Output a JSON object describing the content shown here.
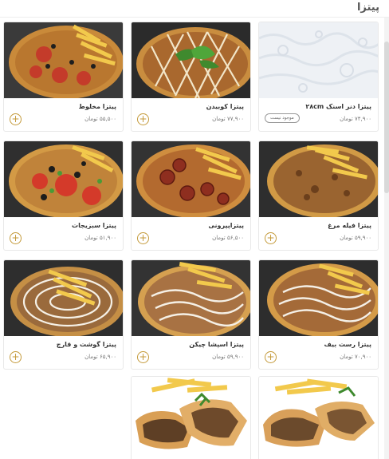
{
  "section": {
    "title": "پیتزا"
  },
  "colors": {
    "accent": "#c49a3a",
    "border": "#e8e8e8"
  },
  "products": [
    {
      "name": "پیتزا دنر اسنک ۲۸cm",
      "price": "۷۴,۹۰۰ تومان",
      "status": "موجود نیست",
      "image": "placeholder-pattern"
    },
    {
      "name": "پیتزا کوبیدن",
      "price": "۷۷,۹۰۰ تومان",
      "add_icon": "plus-icon",
      "image": "kubideh-pizza"
    },
    {
      "name": "پیتزا مخلوط",
      "price": "۵۵,۵۰۰ تومان",
      "add_icon": "plus-icon",
      "image": "mixed-pizza"
    },
    {
      "name": "پیتزا فیله مرغ",
      "price": "۵۹,۹۰۰ تومان",
      "add_icon": "plus-icon",
      "image": "chicken-fillet-pizza"
    },
    {
      "name": "پیتزاپپرونی",
      "price": "۵۶,۵۰۰ تومان",
      "add_icon": "plus-icon",
      "image": "pepperoni-pizza"
    },
    {
      "name": "پیتزا سبزیجات",
      "price": "۵۱,۹۰۰ تومان",
      "add_icon": "plus-icon",
      "image": "vegetable-pizza"
    },
    {
      "name": "پیتزا رست بیف",
      "price": "۷۰,۹۰۰ تومان",
      "add_icon": "plus-icon",
      "image": "roast-beef-pizza"
    },
    {
      "name": "پیتزا اسپشا چیکن",
      "price": "۵۹,۹۰۰ تومان",
      "add_icon": "plus-icon",
      "image": "special-chicken-pizza"
    },
    {
      "name": "پیتزا گوشت و قارچ",
      "price": "۶۵,۹۰۰ تومان",
      "add_icon": "plus-icon",
      "image": "meat-mushroom-pizza"
    },
    {
      "image": "stuffed-bread-fries"
    },
    {
      "image": "stuffed-bread-fries-garnish"
    }
  ]
}
